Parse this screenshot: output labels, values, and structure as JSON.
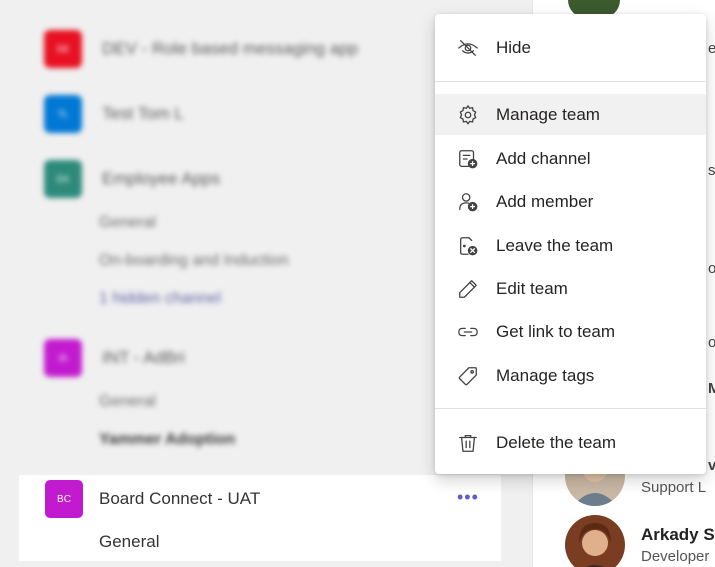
{
  "sidebar": {
    "teams": [
      {
        "initials": "DE",
        "name": "DEV - Role based messaging app",
        "color": "#e81123"
      },
      {
        "initials": "TL",
        "name": "Test Tom L",
        "color": "#0078d4"
      },
      {
        "initials": "EA",
        "name": "Employee Apps",
        "color": "#2d8a7a"
      },
      {
        "initials": "IA",
        "name": "INT - AdBri",
        "color": "#c21bcf"
      }
    ],
    "employee_apps_channels": [
      "General",
      "On-boarding and Induction",
      "1 hidden channel"
    ],
    "int_channels": [
      "General",
      "Yammer Adoption"
    ],
    "board_connect": {
      "initials": "BC",
      "name": "Board Connect - UAT",
      "more": "•••",
      "channel": "General",
      "color": "#c21bcf"
    }
  },
  "menu": {
    "items": [
      {
        "label": "Hide",
        "icon": "hide-icon"
      },
      {
        "label": "Manage team",
        "icon": "gear-icon"
      },
      {
        "label": "Add channel",
        "icon": "add-channel-icon"
      },
      {
        "label": "Add member",
        "icon": "add-member-icon"
      },
      {
        "label": "Leave the team",
        "icon": "leave-icon"
      },
      {
        "label": "Edit team",
        "icon": "pencil-icon"
      },
      {
        "label": "Get link to team",
        "icon": "link-icon"
      },
      {
        "label": "Manage tags",
        "icon": "tag-icon"
      },
      {
        "label": "Delete the team",
        "icon": "trash-icon"
      }
    ]
  },
  "people": [
    {
      "name": "",
      "role": "Support L"
    },
    {
      "name": "Arkady S",
      "role": "Developer"
    }
  ],
  "right_edge_chars": [
    "ev",
    "s",
    "or",
    "ol",
    "M",
    "v"
  ]
}
